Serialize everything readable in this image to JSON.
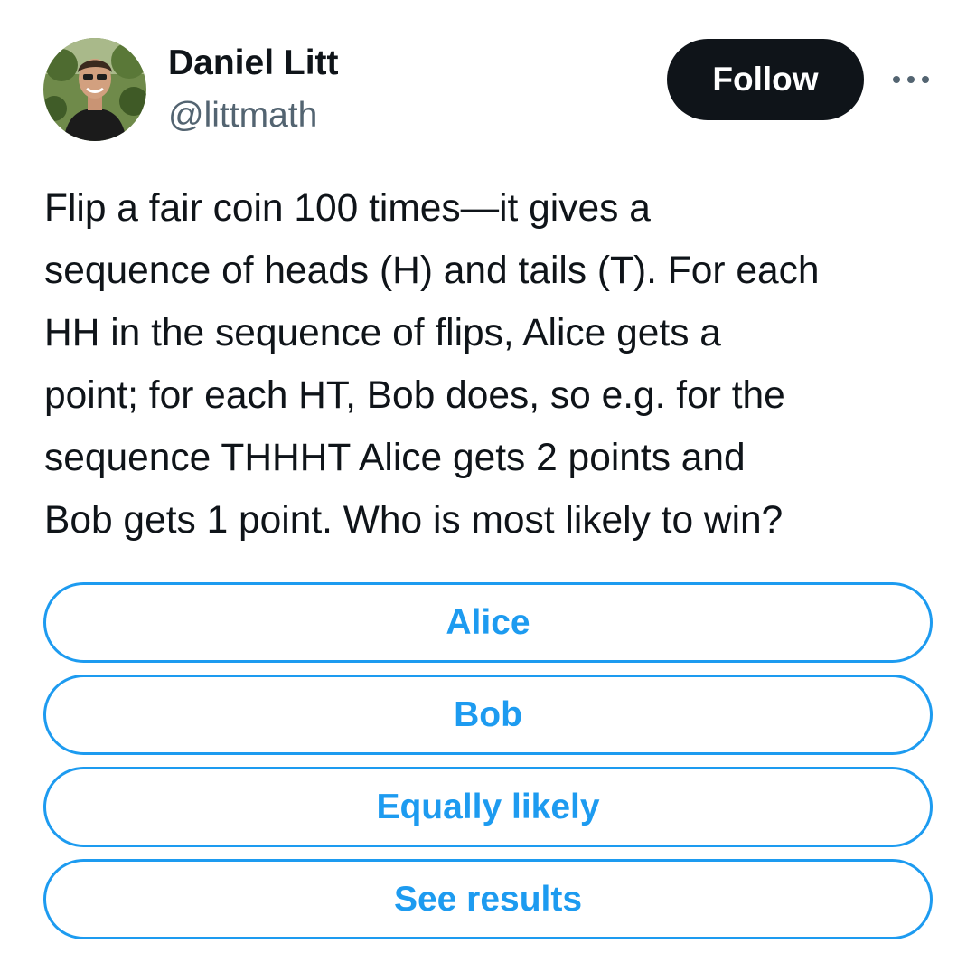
{
  "author": {
    "display_name": "Daniel Litt",
    "handle": "@littmath",
    "avatar_icon": "user-avatar-photo"
  },
  "actions": {
    "follow_label": "Follow",
    "more_icon": "more-dots-icon"
  },
  "tweet": {
    "text": "Flip a fair coin 100 times—it gives a\nsequence of heads (H) and tails (T). For each\nHH in the sequence of flips, Alice gets a\npoint; for each HT, Bob does, so e.g. for the\nsequence THHHT Alice gets 2 points and\nBob gets 1 point. Who is most likely to win?"
  },
  "poll": {
    "options": [
      {
        "label": "Alice"
      },
      {
        "label": "Bob"
      },
      {
        "label": "Equally likely"
      },
      {
        "label": "See results"
      }
    ]
  },
  "colors": {
    "accent": "#1d9bf0",
    "text_primary": "#0f1419",
    "text_secondary": "#536471",
    "button_dark": "#0f1419",
    "background": "#ffffff"
  }
}
